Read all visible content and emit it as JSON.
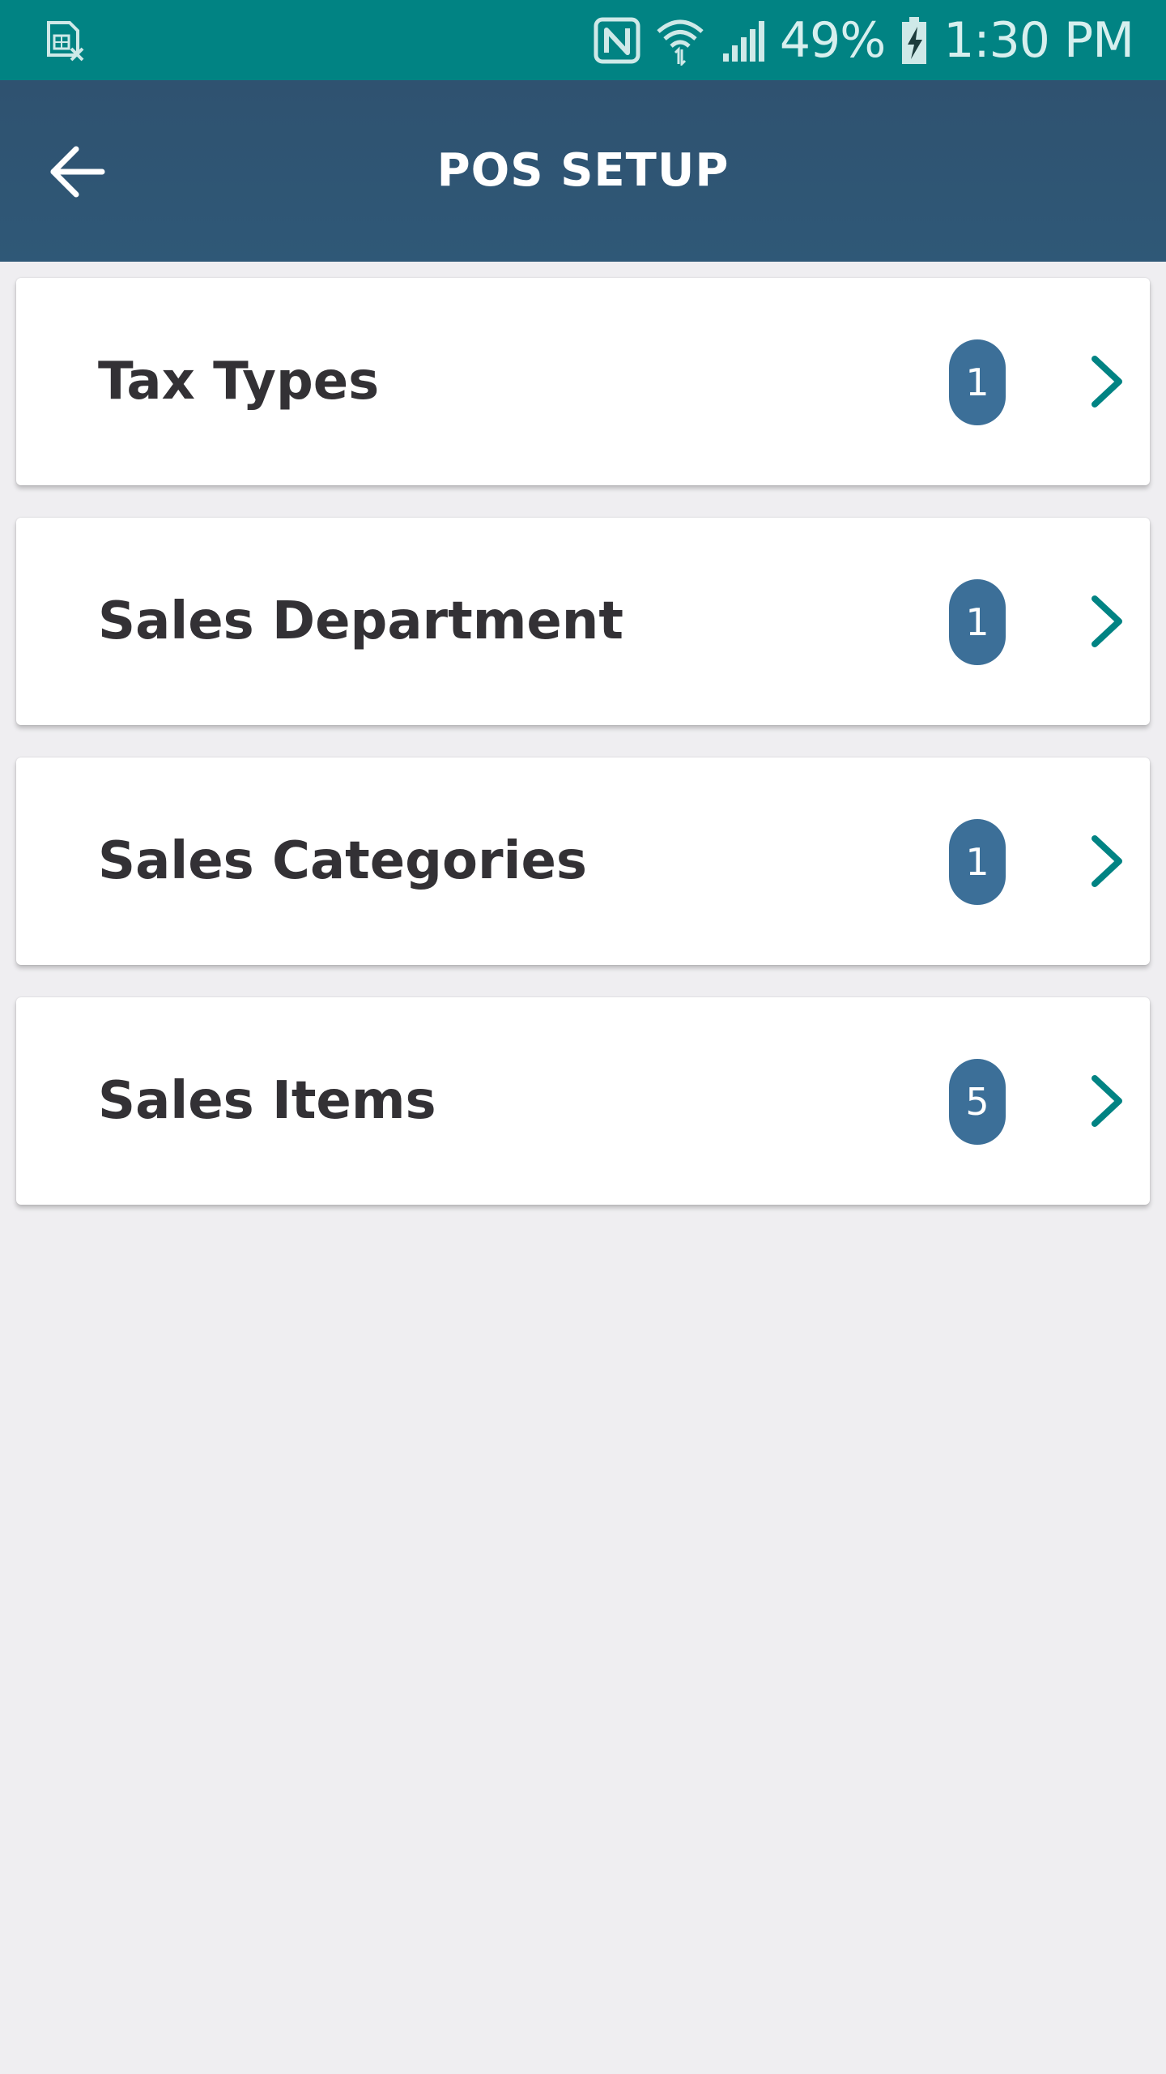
{
  "status_bar": {
    "battery_percent": "49%",
    "time": "1:30 PM",
    "background_color": "#018383",
    "icons": [
      "sim-card-icon",
      "nfc-icon",
      "wifi-icon",
      "signal-icon",
      "battery-charging-icon"
    ]
  },
  "app_bar": {
    "title": "POS SETUP",
    "back_icon": "arrow-left-icon",
    "background_color": "#2f5572"
  },
  "list": {
    "items": [
      {
        "label": "Tax Types",
        "count": "1"
      },
      {
        "label": "Sales Department",
        "count": "1"
      },
      {
        "label": "Sales Categories",
        "count": "1"
      },
      {
        "label": "Sales Items",
        "count": "5"
      }
    ],
    "badge_color": "#3c6f98",
    "chevron_color": "#018383",
    "chevron_icon": "chevron-right-icon"
  }
}
